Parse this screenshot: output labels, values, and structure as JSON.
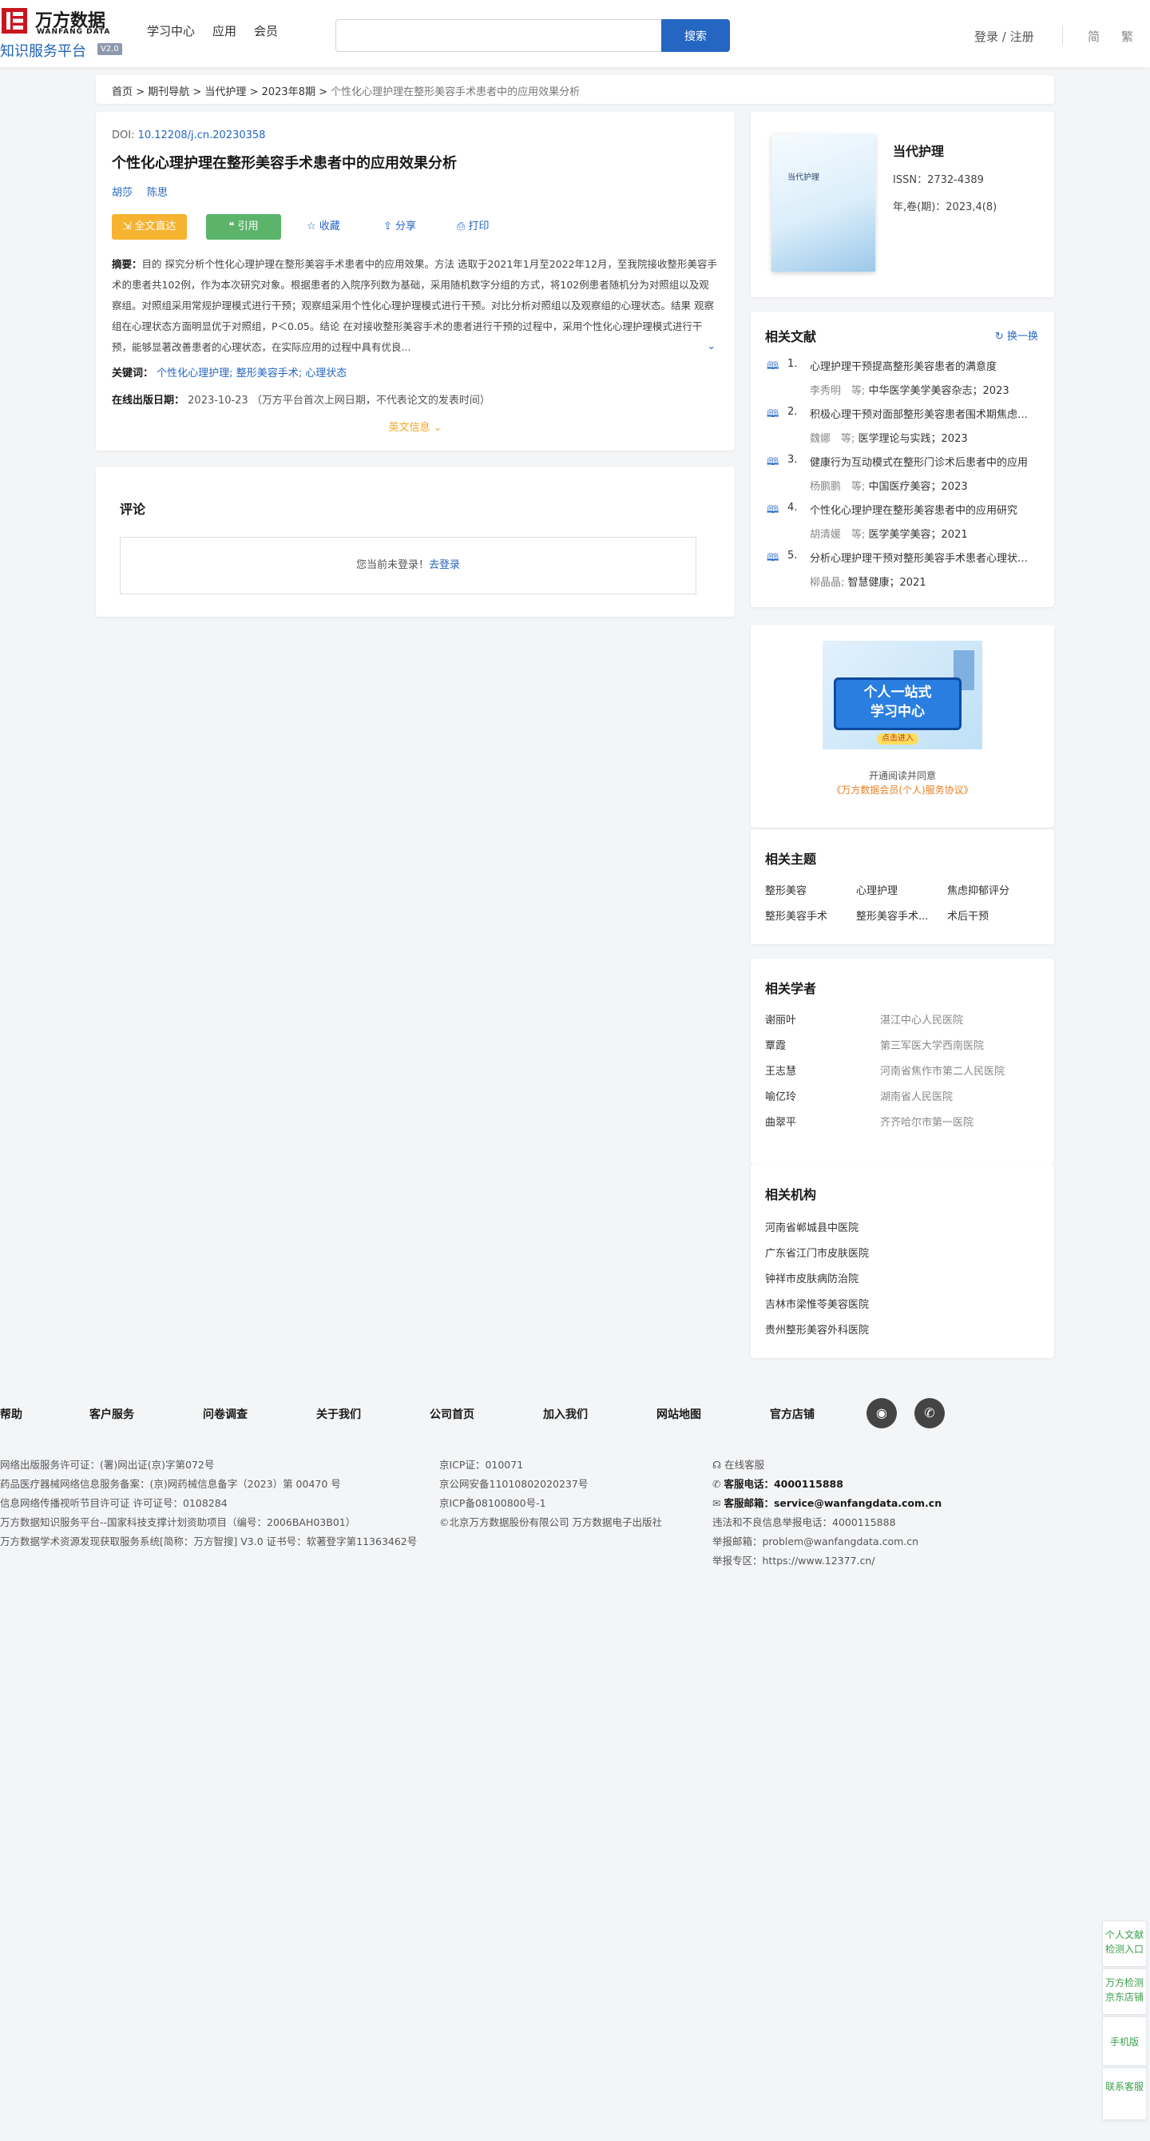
{
  "header": {
    "logo_mark": "",
    "logo_cn": "万方数据",
    "logo_en": "WANFANG DATA",
    "logo_sub": "知识服务平台",
    "logo_ver": "V2.0",
    "nav": [
      "学习中心",
      "应用",
      "会员"
    ],
    "search_placeholder": "",
    "search_button": "搜索",
    "login": "登录 / 注册",
    "lang_simplified": "简",
    "lang_traditional": "繁"
  },
  "breadcrumb": {
    "items": [
      "首页",
      "期刊导航",
      "当代护理",
      "2023年8期"
    ],
    "separator": ">",
    "current": "个性化心理护理在整形美容手术患者中的应用效果分析"
  },
  "article": {
    "doi_label": "DOI:",
    "doi": "10.12208/j.cn.20230358",
    "title": "个性化心理护理在整形美容手术患者中的应用效果分析",
    "authors": [
      "胡莎",
      "陈思"
    ],
    "btn_fulltext": "全文直达",
    "btn_cite": "引用",
    "btn_favorite": "收藏",
    "btn_share": "分享",
    "btn_print": "打印",
    "abstract_label": "摘要：",
    "abstract": "目的 探究分析个性化心理护理在整形美容手术患者中的应用效果。方法 选取于2021年1月至2022年12月，至我院接收整形美容手术的患者共102例，作为本次研究对象。根据患者的入院序列数为基础，采用随机数字分组的方式，将102例患者随机分为对照组以及观察组。对照组采用常规护理模式进行干预；观察组采用个性化心理护理模式进行干预。对比分析对照组以及观察组的心理状态。结果 观察组在心理状态方面明显优于对照组，P＜0.05。结论 在对接收整形美容手术的患者进行干预的过程中，采用个性化心理护理模式进行干预，能够显著改善患者的心理状态，在实际应用的过程中具有优良...",
    "keywords_label": "关键词：",
    "keywords": [
      "个性化心理护理;",
      "整形美容手术;",
      "心理状态"
    ],
    "pubdate_label": "在线出版日期：",
    "pubdate": "2023-10-23",
    "pubdate_note": "（万方平台首次上网日期，不代表论文的发表时间）",
    "english_info": "英文信息"
  },
  "comment": {
    "title": "评论",
    "not_logged": "您当前未登录！",
    "login_link": "去登录"
  },
  "journal": {
    "cover_text": "当代护理",
    "name": "当代护理",
    "issn": "ISSN：2732-4389",
    "volume": "年,卷(期)：2023,4(8)"
  },
  "related_docs": {
    "title": "相关文献",
    "refresh": "换一换",
    "items": [
      {
        "num": "1.",
        "title": "心理护理干预提高整形美容患者的满意度",
        "authors": "李秀明　等;",
        "source": "中华医学美学美容杂志；2023"
      },
      {
        "num": "2.",
        "title": "积极心理干预对面部整形美容患者围术期焦虑的影响",
        "authors": "魏娜　等;",
        "source": "医学理论与实践；2023"
      },
      {
        "num": "3.",
        "title": "健康行为互动模式在整形门诊术后患者中的应用",
        "authors": "杨鹏鹏　等;",
        "source": "中国医疗美容；2023"
      },
      {
        "num": "4.",
        "title": "个性化心理护理在整形美容患者中的应用研究",
        "authors": "胡清媛　等;",
        "source": "医学美学美容；2021"
      },
      {
        "num": "5.",
        "title": "分析心理护理干预对整形美容手术患者心理状态的影响",
        "authors": "柳晶晶;",
        "source": "智慧健康；2021"
      }
    ]
  },
  "promo": {
    "banner_line1": "个人一站式",
    "banner_line2": "学习中心",
    "banner_cta": "点击进入",
    "text1": "开通阅读并同意",
    "text2": "《万方数据会员(个人)服务协议》"
  },
  "topics": {
    "title": "相关主题",
    "items": [
      "整形美容",
      "心理护理",
      "焦虑抑郁评分",
      "整形美容手术",
      "整形美容手术...",
      "术后干预"
    ]
  },
  "scholars": {
    "title": "相关学者",
    "items": [
      {
        "name": "谢丽叶",
        "org": "湛江中心人民医院"
      },
      {
        "name": "覃霞",
        "org": "第三军医大学西南医院"
      },
      {
        "name": "王志慧",
        "org": "河南省焦作市第二人民医院"
      },
      {
        "name": "喻亿玲",
        "org": "湖南省人民医院"
      },
      {
        "name": "曲翠平",
        "org": "齐齐哈尔市第一医院"
      }
    ]
  },
  "institutions": {
    "title": "相关机构",
    "items": [
      "河南省郸城县中医院",
      "广东省江门市皮肤医院",
      "钟祥市皮肤病防治院",
      "吉林市梁惟苓美容医院",
      "贵州整形美容外科医院"
    ]
  },
  "footer": {
    "nav": [
      "帮助",
      "客户服务",
      "问卷调查",
      "关于我们",
      "公司首页",
      "加入我们",
      "网站地图",
      "官方店铺"
    ],
    "col1": [
      "网络出版服务许可证：(署)网出证(京)字第072号",
      "药品医疗器械网络信息服务备案：(京)网药械信息备字（2023）第 00470 号",
      "信息网络传播视听节目许可证 许可证号：0108284",
      "万方数据知识服务平台--国家科技支撑计划资助项目（编号：2006BAH03B01）",
      "万方数据学术资源发现获取服务系统[简称：万方智搜] V3.0 证书号：软著登字第11363462号"
    ],
    "col2": [
      "京ICP证：010071",
      "京公网安备11010802020237号",
      "京ICP备08100800号-1",
      "©北京万方数据股份有限公司 万方数据电子出版社"
    ],
    "online_service": "在线客服",
    "phone_label": "客服电话：",
    "phone": "4000115888",
    "email_label": "客服邮箱：",
    "email": "service@wanfangdata.com.cn",
    "report_phone": "违法和不良信息举报电话：4000115888",
    "report_email": "举报邮箱：problem@wanfangdata.com.cn",
    "report_site": "举报专区：https://www.12377.cn/"
  },
  "side_tools": [
    "个人文献检测入口",
    "万方检测京东店铺",
    "手机版",
    "联系客服"
  ]
}
